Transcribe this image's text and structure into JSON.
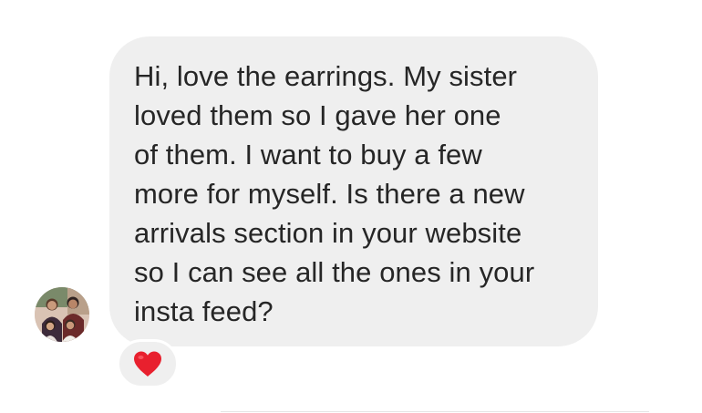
{
  "message": {
    "lines": [
      "Hi, love the earrings. My sister",
      "loved them so I gave her one",
      "of them. I want to buy a few",
      "more for myself. Is there a new",
      "arrivals section in your website",
      "so I can see all the ones in your",
      "insta feed?"
    ]
  },
  "reaction": {
    "icon": "red-heart-icon",
    "color": "#e8202e"
  },
  "avatar": {
    "icon": "profile-photo"
  },
  "colors": {
    "bubble": "#efefef",
    "text": "#262626",
    "background": "#ffffff"
  }
}
